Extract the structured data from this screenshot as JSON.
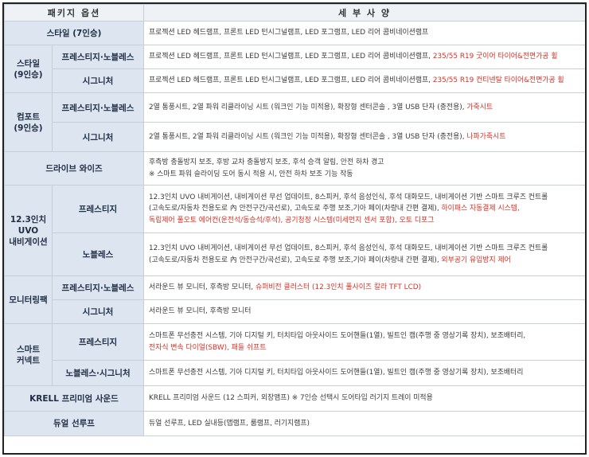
{
  "header": {
    "col1": "패키지 옵션",
    "col2": "세 부 사 양"
  },
  "rows": {
    "style7": {
      "category": "스타일 (7인승)",
      "detail": "프로젝션 LED 헤드램프, 프론트 LED 턴시그널램프, LED 포그램프, LED 리어 콤비네이션램프"
    },
    "style9": {
      "category_l1": "스타일",
      "category_l2": "(9인승)",
      "prestige": {
        "label": "프레스티지·노블레스",
        "detail": "프로젝션 LED 헤드램프, 프론트 LED 턴시그널램프, LED 포그램프, LED 리어 콤비네이션램프, ",
        "detail_red": "235/55 R19 굿이어 타이어&전면가공 휠"
      },
      "signature": {
        "label": "시그니처",
        "detail": "프로젝션 LED 헤드램프, 프론트 LED 턴시그널램프, LED 포그램프, LED 리어 콤비네이션램프, ",
        "detail_red": "235/55 R19 컨티넨탈 타이어&전면가공 휠"
      }
    },
    "comfort": {
      "category_l1": "컴포트",
      "category_l2": "(9인승)",
      "prestige": {
        "label": "프레스티지·노블레스",
        "detail": "2열 통풍시트, 2열 파워 리클라이닝 시트 (워크인 기능 미적용), 확장형 센터콘솔 , 3열 USB 단자 (충전용), ",
        "detail_red": "가죽시트"
      },
      "signature": {
        "label": "시그니처",
        "detail": "2열 통풍시트, 2열 파워 리클라이닝 시트 (워크인 기능 미적용), 확장형 센터콘솔 , 3열 USB 단자 (충전용), ",
        "detail_red": "나파가죽시트"
      }
    },
    "drivewise": {
      "category": "드라이브 와이즈",
      "detail_l1": "후측방 충돌방지 보조, 후방 교차 충돌방지 보조, 후석 승객 알림, 안전 하차 경고",
      "detail_l2": "※ 스마트 파워 슬라이딩 도어 동시 적용 시, 안전 하차 보조 기능 작동"
    },
    "nav": {
      "category_l1": "12.3인치",
      "category_l2": "UVO",
      "category_l3": "내비게이션",
      "prestige": {
        "label": "프레스티지",
        "l1": "12.3인치 UVO 내비게이션, 내비게이션 무선 업데이트, 8스피커, 후석 음성인식, 후석 대화모드, 내비게이션 기반 스마트 크루즈 컨트롤",
        "l2": "(고속도로/자동차 전용도로 內 안전구간/곡선로), 고속도로 주행 보조,기아 페이(차량내 간편 결제), ",
        "l2_red": "하이패스 자동결제 시스템,",
        "l3_red": "독립제어 풀오토 에어컨(운전석/동승석/후석), 공기청정 시스템(미세먼지 센서 포함), 오토 디포그"
      },
      "noblesse": {
        "label": "노블레스",
        "l1": "12.3인치 UVO 내비게이션, 내비게이션 무선 업데이트, 8스피커, 후석 음성인식, 후석 대화모드, 내비게이션 기반 스마트 크루즈 컨트롤",
        "l2": "(고속도로/자동차 전용도로 內 안전구간/곡선로), 고속도로 주행 보조,기아 페이(차량내 간편 결제), ",
        "l2_red": "외부공기 유입방지 제어"
      }
    },
    "monitoring": {
      "category": "모니터링팩",
      "prestige": {
        "label": "프레스티지·노블레스",
        "detail": "서라운드 뷰 모니터, 후측방 모니터, ",
        "detail_red": "슈퍼비전 클러스터 (12.3인치 풀사이즈 칼라 TFT LCD)"
      },
      "signature": {
        "label": "시그니처",
        "detail": "서라운드 뷰 모니터, 후측방 모니터"
      }
    },
    "smart": {
      "category_l1": "스마트",
      "category_l2": "커넥트",
      "prestige": {
        "label": "프레스티지",
        "l1": "스마트폰 무선충전 시스템, 기아 디지털 키, 터치타입 아웃사이드 도어핸들(1열), 빌트인 캠(주행 중 영상기록 장치), 보조배터리,",
        "l2_red": "전자식 변속 다이얼(SBW), 패들 쉬프트"
      },
      "noblesse": {
        "label": "노블레스·시그니처",
        "detail": "스마트폰 무선충전 시스템, 기아 디지털 키, 터치타입 아웃사이드 도어핸들(1열), 빌트인 캠(주행 중 영상기록 장치), 보조배터리"
      }
    },
    "krell": {
      "category": "KRELL 프리미엄 사운드",
      "detail": "KRELL 프리미엄 사운드 (12 스피커, 외장앰프)  ※ 7인승 선택시 도어타입 러기지 트레이 미적용"
    },
    "dual": {
      "category": "듀얼 선루프",
      "detail": "듀얼 선루프, LED 실내등(맵램프, 룸램프, 러기지램프)"
    }
  }
}
